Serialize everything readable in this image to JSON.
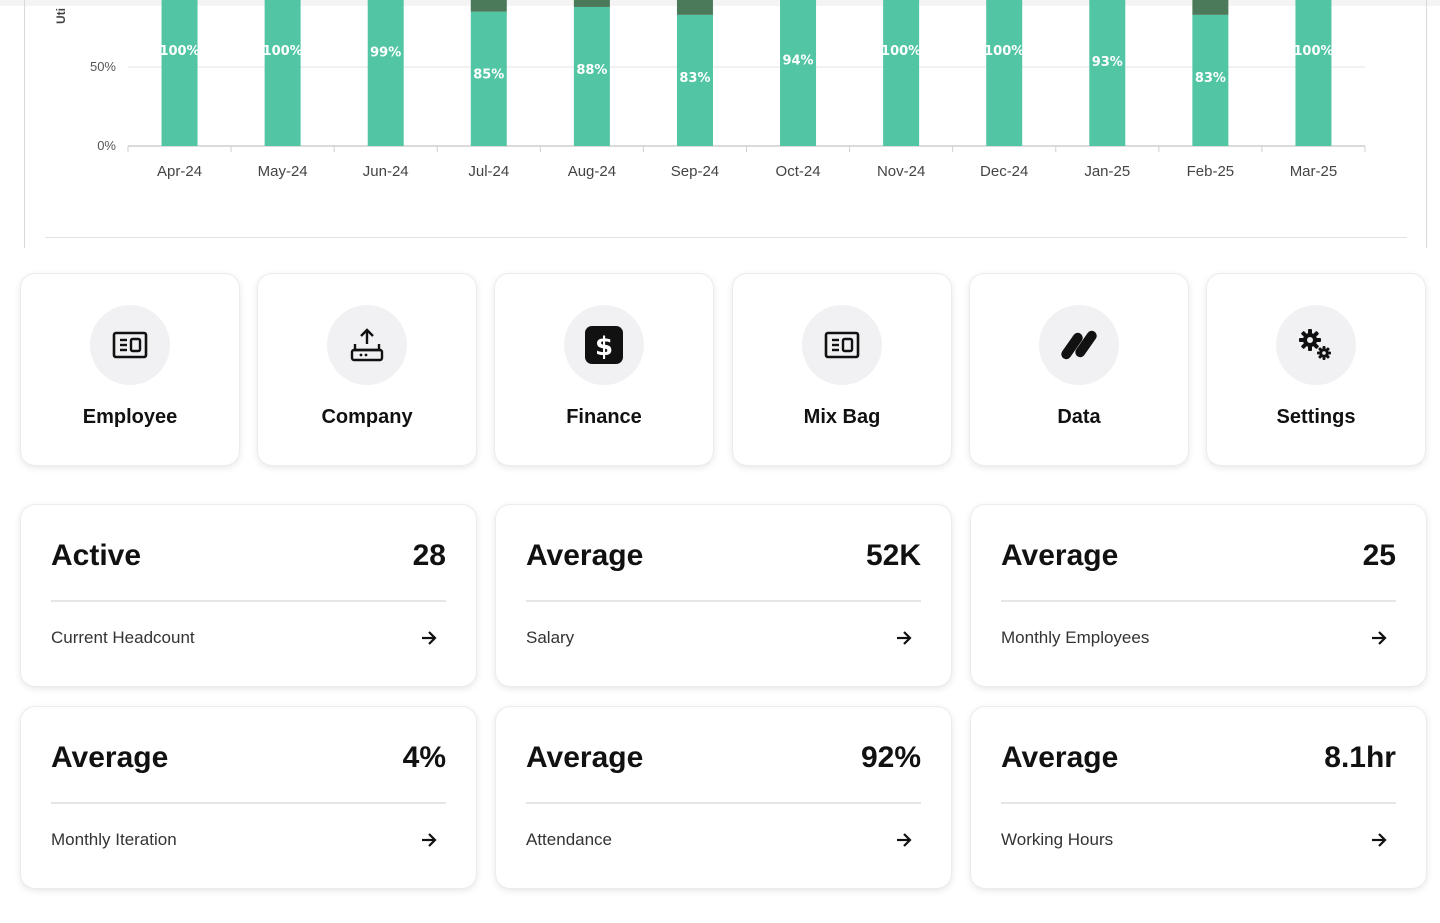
{
  "chart_data": {
    "type": "bar",
    "stacked": true,
    "ylabel": "Uti",
    "ylim": [
      0,
      100
    ],
    "y_ticks": [
      "0%",
      "50%"
    ],
    "categories": [
      "Apr-24",
      "May-24",
      "Jun-24",
      "Jul-24",
      "Aug-24",
      "Sep-24",
      "Oct-24",
      "Nov-24",
      "Dec-24",
      "Jan-25",
      "Feb-25",
      "Mar-25"
    ],
    "series": [
      {
        "color": "#52c5a4",
        "values": [
          100,
          100,
          99,
          85,
          88,
          83,
          94,
          100,
          100,
          93,
          83,
          100
        ],
        "labels": [
          "100%",
          "100%",
          "99%",
          "85%",
          "88%",
          "83%",
          "94%",
          "100%",
          "100%",
          "93%",
          "83%",
          "100%"
        ]
      },
      {
        "color": "#4a7a5a",
        "values": [
          0,
          0,
          1,
          15,
          12,
          17,
          6,
          0,
          0,
          7,
          17,
          0
        ]
      }
    ],
    "grid": true
  },
  "nav_cards": [
    {
      "label": "Employee",
      "icon": "id-card-icon"
    },
    {
      "label": "Company",
      "icon": "upload-tray-icon"
    },
    {
      "label": "Finance",
      "icon": "dollar-square-icon"
    },
    {
      "label": "Mix Bag",
      "icon": "id-card-icon"
    },
    {
      "label": "Data",
      "icon": "pills-icon"
    },
    {
      "label": "Settings",
      "icon": "gears-icon"
    }
  ],
  "stats": [
    {
      "title": "Active",
      "value": "28",
      "subtitle": "Current Headcount"
    },
    {
      "title": "Average",
      "value": "52K",
      "subtitle": "Salary"
    },
    {
      "title": "Average",
      "value": "25",
      "subtitle": "Monthly Employees"
    },
    {
      "title": "Average",
      "value": "4%",
      "subtitle": "Monthly Iteration"
    },
    {
      "title": "Average",
      "value": "92%",
      "subtitle": "Attendance"
    },
    {
      "title": "Average",
      "value": "8.1hr",
      "subtitle": "Working Hours"
    }
  ],
  "colors": {
    "primary_bar": "#52c5a4",
    "secondary_bar": "#4a7a5a",
    "card_icon_bg": "#f1f1f3"
  }
}
